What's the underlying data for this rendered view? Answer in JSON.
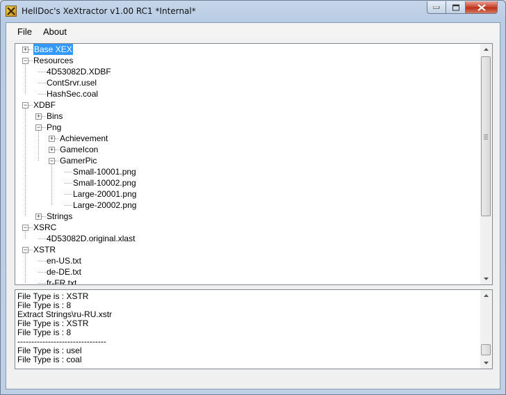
{
  "window": {
    "title": "HellDoc's XeXtractor v1.00 RC1 *Internal*",
    "icon": "x-logo-icon"
  },
  "menu": {
    "file": "File",
    "about": "About"
  },
  "tree": {
    "nodes": [
      {
        "label": "Base XEX",
        "expander": "+",
        "selected": true
      },
      {
        "label": "Resources",
        "expander": "-"
      },
      {
        "label": "4D53082D.XDBF",
        "expander": ""
      },
      {
        "label": "ContSrvr.usel",
        "expander": ""
      },
      {
        "label": "HashSec.coal",
        "expander": ""
      },
      {
        "label": "XDBF",
        "expander": "-"
      },
      {
        "label": "Bins",
        "expander": "+"
      },
      {
        "label": "Png",
        "expander": "-"
      },
      {
        "label": "Achievement",
        "expander": "+"
      },
      {
        "label": "GameIcon",
        "expander": "+"
      },
      {
        "label": "GamerPic",
        "expander": "-"
      },
      {
        "label": "Small-10001.png",
        "expander": ""
      },
      {
        "label": "Small-10002.png",
        "expander": ""
      },
      {
        "label": "Large-20001.png",
        "expander": ""
      },
      {
        "label": "Large-20002.png",
        "expander": ""
      },
      {
        "label": "Strings",
        "expander": "+"
      },
      {
        "label": "XSRC",
        "expander": "-"
      },
      {
        "label": "4D53082D.original.xlast",
        "expander": ""
      },
      {
        "label": "XSTR",
        "expander": "-"
      },
      {
        "label": "en-US.txt",
        "expander": ""
      },
      {
        "label": "de-DE.txt",
        "expander": ""
      },
      {
        "label": "fr-FR.txt",
        "expander": ""
      }
    ]
  },
  "log": {
    "lines": [
      "File Type is : XSTR",
      "File Type is : 8",
      "Extract Strings\\ru-RU.xstr",
      "File Type is : XSTR",
      "File Type is : 8",
      "--------------------------------",
      "File Type is : usel",
      "File Type is : coal"
    ]
  }
}
